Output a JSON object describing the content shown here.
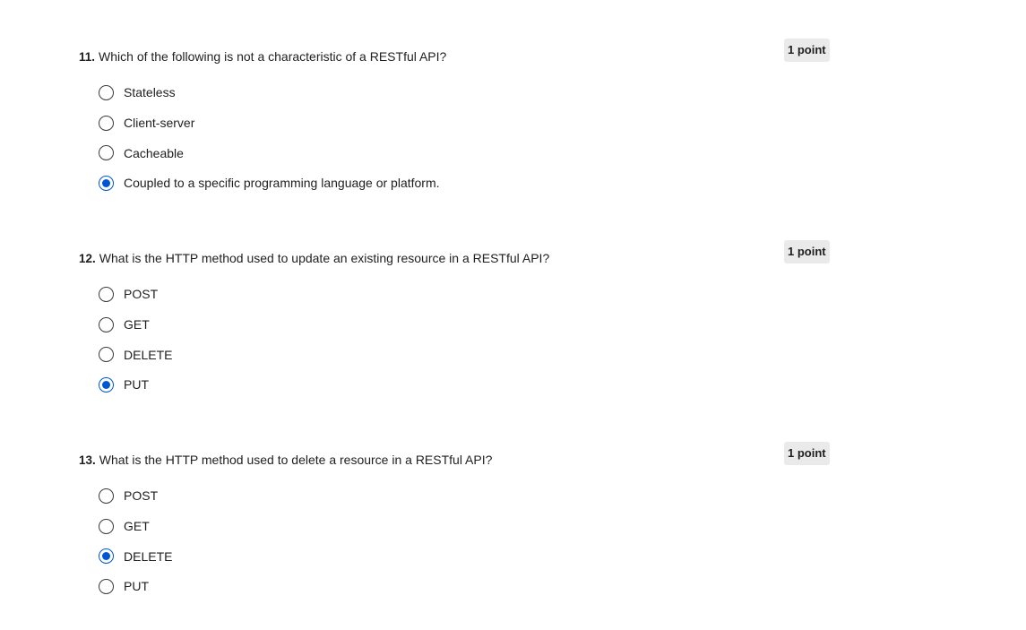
{
  "questions": [
    {
      "number": "11.",
      "text": "Which of the following is not a characteristic of a RESTful API?",
      "points": "1 point",
      "options": [
        {
          "label": "Stateless",
          "selected": false
        },
        {
          "label": "Client-server",
          "selected": false
        },
        {
          "label": "Cacheable",
          "selected": false
        },
        {
          "label": "Coupled to a specific programming language or platform.",
          "selected": true
        }
      ]
    },
    {
      "number": "12.",
      "text": "What is the HTTP method used to update an existing resource in a RESTful API?",
      "points": "1 point",
      "options": [
        {
          "label": "POST",
          "selected": false
        },
        {
          "label": "GET",
          "selected": false
        },
        {
          "label": "DELETE",
          "selected": false
        },
        {
          "label": "PUT",
          "selected": true
        }
      ]
    },
    {
      "number": "13.",
      "text": "What is the HTTP method used to delete a resource in a RESTful API?",
      "points": "1 point",
      "options": [
        {
          "label": "POST",
          "selected": false
        },
        {
          "label": "GET",
          "selected": false
        },
        {
          "label": "DELETE",
          "selected": true
        },
        {
          "label": "PUT",
          "selected": false
        }
      ]
    }
  ],
  "colors": {
    "accent": "#0056d2",
    "points_badge_bg": "#eaeaea",
    "text": "#1f1f1f"
  }
}
